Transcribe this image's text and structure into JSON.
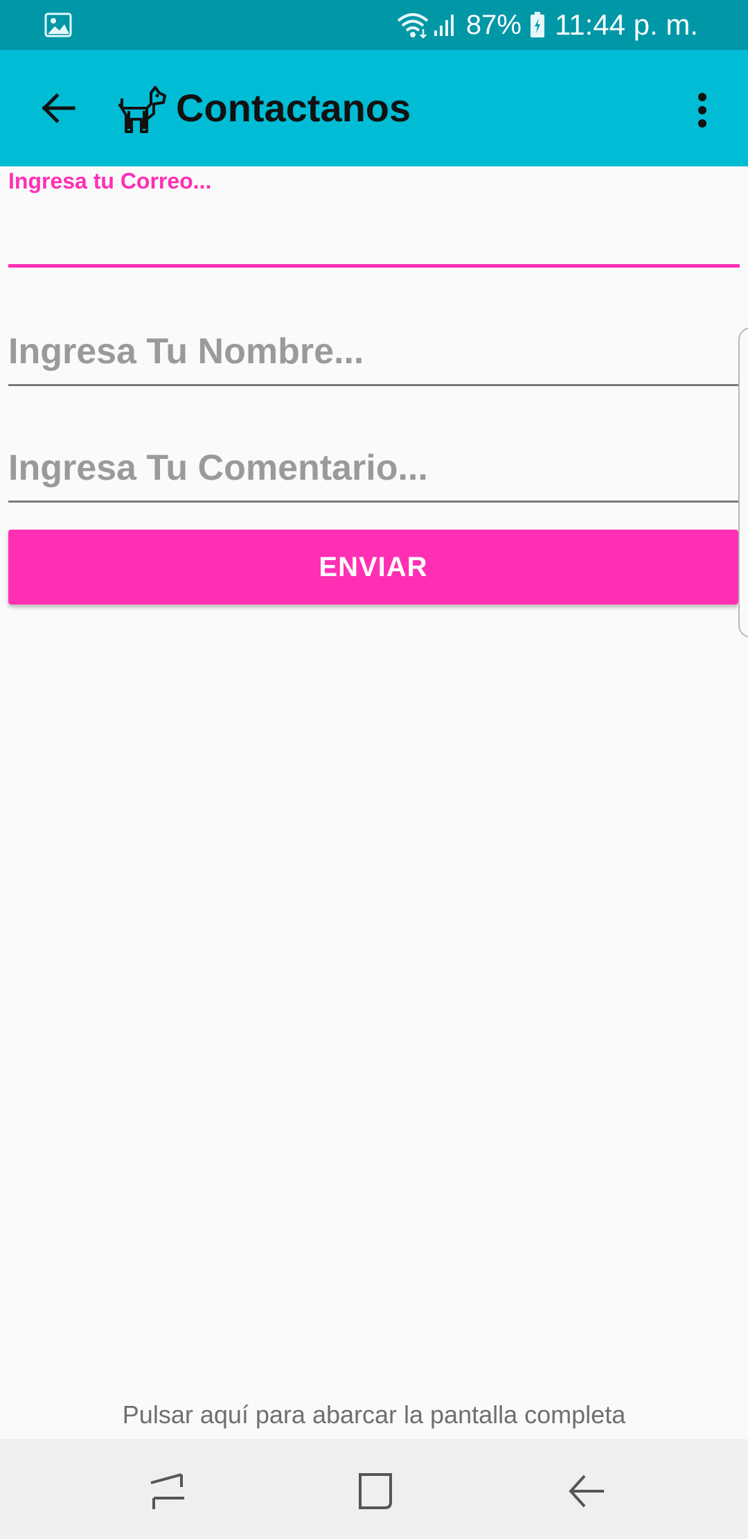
{
  "status_bar": {
    "battery": "87%",
    "time": "11:44 p. m.",
    "icons": [
      "image-icon",
      "wifi-icon",
      "signal-icon",
      "battery-charging-icon"
    ]
  },
  "app_bar": {
    "title": "Contactanos",
    "back_icon": "arrow-back-icon",
    "logo_icon": "dog-icon",
    "menu_icon": "overflow-menu-icon"
  },
  "form": {
    "email": {
      "label": "Ingresa tu Correo...",
      "value": ""
    },
    "name": {
      "placeholder": "Ingresa Tu Nombre..."
    },
    "comment": {
      "placeholder": "Ingresa Tu Comentario..."
    },
    "submit_label": "ENVIAR"
  },
  "fullscreen_hint": "Pulsar aquí para abarcar la pantalla completa",
  "nav_bar": {
    "icons": [
      "recents-icon",
      "home-icon",
      "back-icon"
    ]
  },
  "colors": {
    "status_bar": "#0097a7",
    "app_bar": "#00bcd4",
    "accent": "#ff2fb4",
    "background": "#fafafa"
  }
}
